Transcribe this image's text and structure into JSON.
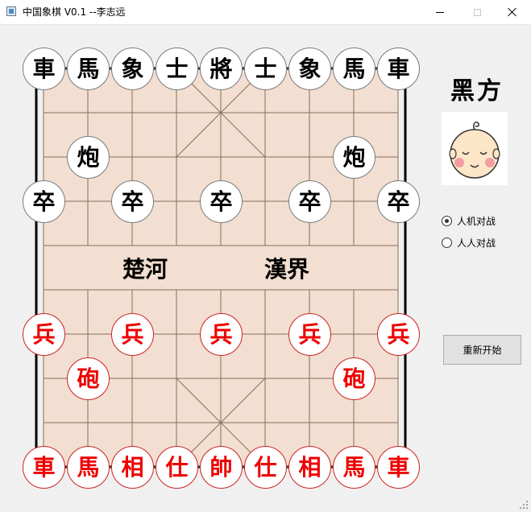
{
  "window": {
    "title": "中国象棋 V0.1 --李志远",
    "icon": "app-icon"
  },
  "board": {
    "river_left": "楚河",
    "river_right": "漢界",
    "colors": {
      "board_bg": "#f2dfd1",
      "grid_line": "#8b6e57",
      "red_piece": "#ee0000",
      "black_piece": "#000000"
    }
  },
  "pieces": [
    {
      "text": "車",
      "side": "black",
      "col": 0,
      "row": 0
    },
    {
      "text": "馬",
      "side": "black",
      "col": 1,
      "row": 0
    },
    {
      "text": "象",
      "side": "black",
      "col": 2,
      "row": 0
    },
    {
      "text": "士",
      "side": "black",
      "col": 3,
      "row": 0
    },
    {
      "text": "將",
      "side": "black",
      "col": 4,
      "row": 0
    },
    {
      "text": "士",
      "side": "black",
      "col": 5,
      "row": 0
    },
    {
      "text": "象",
      "side": "black",
      "col": 6,
      "row": 0
    },
    {
      "text": "馬",
      "side": "black",
      "col": 7,
      "row": 0
    },
    {
      "text": "車",
      "side": "black",
      "col": 8,
      "row": 0
    },
    {
      "text": "炮",
      "side": "black",
      "col": 1,
      "row": 2
    },
    {
      "text": "炮",
      "side": "black",
      "col": 7,
      "row": 2
    },
    {
      "text": "卒",
      "side": "black",
      "col": 0,
      "row": 3
    },
    {
      "text": "卒",
      "side": "black",
      "col": 2,
      "row": 3
    },
    {
      "text": "卒",
      "side": "black",
      "col": 4,
      "row": 3
    },
    {
      "text": "卒",
      "side": "black",
      "col": 6,
      "row": 3
    },
    {
      "text": "卒",
      "side": "black",
      "col": 8,
      "row": 3
    },
    {
      "text": "兵",
      "side": "red",
      "col": 0,
      "row": 6
    },
    {
      "text": "兵",
      "side": "red",
      "col": 2,
      "row": 6
    },
    {
      "text": "兵",
      "side": "red",
      "col": 4,
      "row": 6
    },
    {
      "text": "兵",
      "side": "red",
      "col": 6,
      "row": 6
    },
    {
      "text": "兵",
      "side": "red",
      "col": 8,
      "row": 6
    },
    {
      "text": "砲",
      "side": "red",
      "col": 1,
      "row": 7
    },
    {
      "text": "砲",
      "side": "red",
      "col": 7,
      "row": 7
    },
    {
      "text": "車",
      "side": "red",
      "col": 0,
      "row": 9
    },
    {
      "text": "馬",
      "side": "red",
      "col": 1,
      "row": 9
    },
    {
      "text": "相",
      "side": "red",
      "col": 2,
      "row": 9
    },
    {
      "text": "仕",
      "side": "red",
      "col": 3,
      "row": 9
    },
    {
      "text": "帥",
      "side": "red",
      "col": 4,
      "row": 9
    },
    {
      "text": "仕",
      "side": "red",
      "col": 5,
      "row": 9
    },
    {
      "text": "相",
      "side": "red",
      "col": 6,
      "row": 9
    },
    {
      "text": "馬",
      "side": "red",
      "col": 7,
      "row": 9
    },
    {
      "text": "車",
      "side": "red",
      "col": 8,
      "row": 9
    }
  ],
  "sidebar": {
    "turn_label": "黑方",
    "avatar_icon": "baby-face-icon",
    "modes": [
      {
        "label": "人机对战",
        "checked": true
      },
      {
        "label": "人人对战",
        "checked": false
      }
    ],
    "restart_label": "重新开始"
  }
}
